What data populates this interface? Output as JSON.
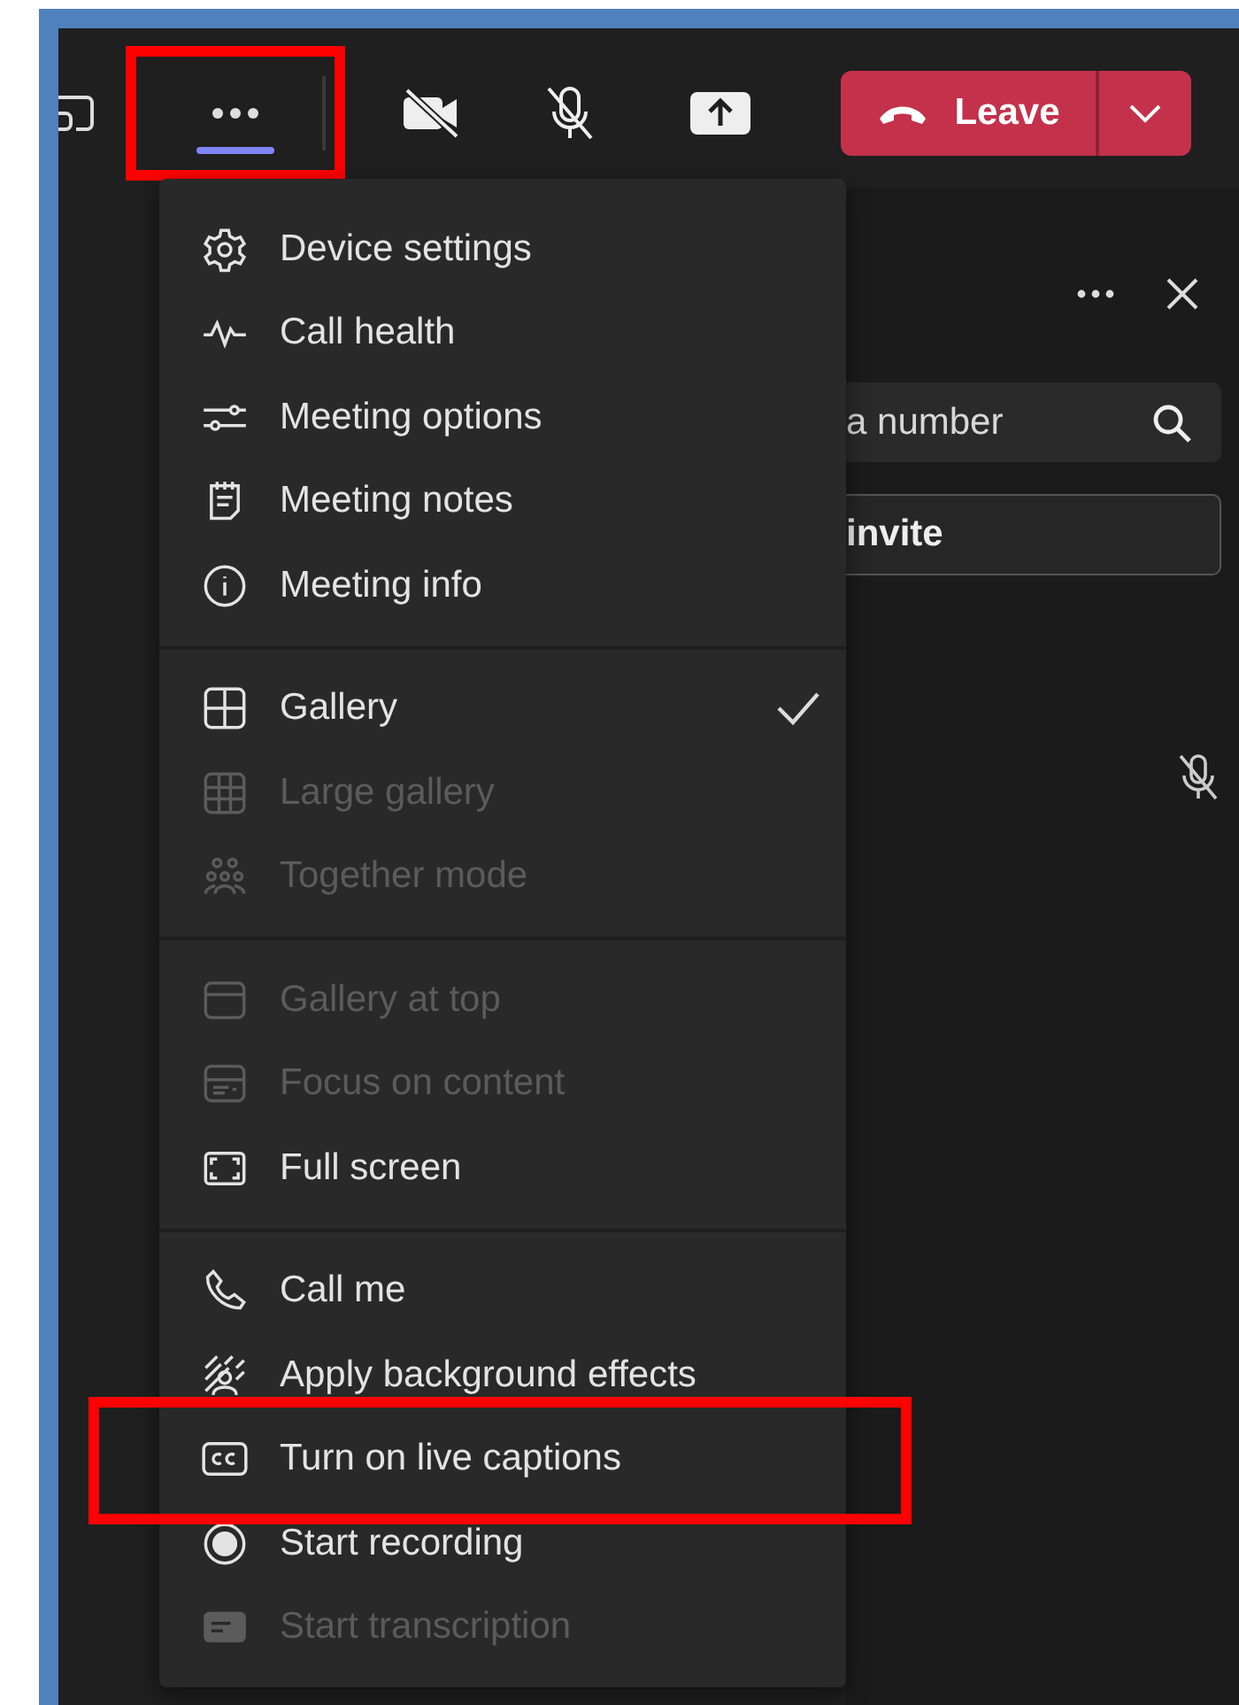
{
  "toolbar": {
    "more_button": {
      "selected": true,
      "highlighted": true
    },
    "leave_button": {
      "label": "Leave"
    }
  },
  "side_panel": {
    "search": {
      "placeholder": "a number"
    },
    "invite_button": {
      "label": "invite"
    }
  },
  "menu": {
    "sections": [
      {
        "items": [
          {
            "kind": "gear",
            "label": "Device settings",
            "disabled": false,
            "checked": false
          },
          {
            "kind": "pulse",
            "label": "Call health",
            "disabled": false,
            "checked": false
          },
          {
            "kind": "sliders",
            "label": "Meeting options",
            "disabled": false,
            "checked": false
          },
          {
            "kind": "notes",
            "label": "Meeting notes",
            "disabled": false,
            "checked": false
          },
          {
            "kind": "info",
            "label": "Meeting info",
            "disabled": false,
            "checked": false
          }
        ]
      },
      {
        "items": [
          {
            "kind": "grid",
            "label": "Gallery",
            "disabled": false,
            "checked": true
          },
          {
            "kind": "biggrid",
            "label": "Large gallery",
            "disabled": true,
            "checked": false
          },
          {
            "kind": "people",
            "label": "Together mode",
            "disabled": true,
            "checked": false
          }
        ]
      },
      {
        "items": [
          {
            "kind": "topbar",
            "label": "Gallery at top",
            "disabled": true,
            "checked": false
          },
          {
            "kind": "focus",
            "label": "Focus on content",
            "disabled": true,
            "checked": false
          },
          {
            "kind": "fullscreen",
            "label": "Full screen",
            "disabled": false,
            "checked": false
          }
        ]
      },
      {
        "items": [
          {
            "kind": "phone",
            "label": "Call me",
            "disabled": false,
            "checked": false
          },
          {
            "kind": "effects",
            "label": "Apply background effects",
            "disabled": false,
            "checked": false
          },
          {
            "kind": "cc",
            "label": "Turn on live captions",
            "disabled": false,
            "checked": false,
            "highlighted": true
          },
          {
            "kind": "record",
            "label": "Start recording",
            "disabled": false,
            "checked": false
          },
          {
            "kind": "transcript",
            "label": "Start transcription",
            "disabled": true,
            "checked": false
          }
        ]
      }
    ]
  }
}
